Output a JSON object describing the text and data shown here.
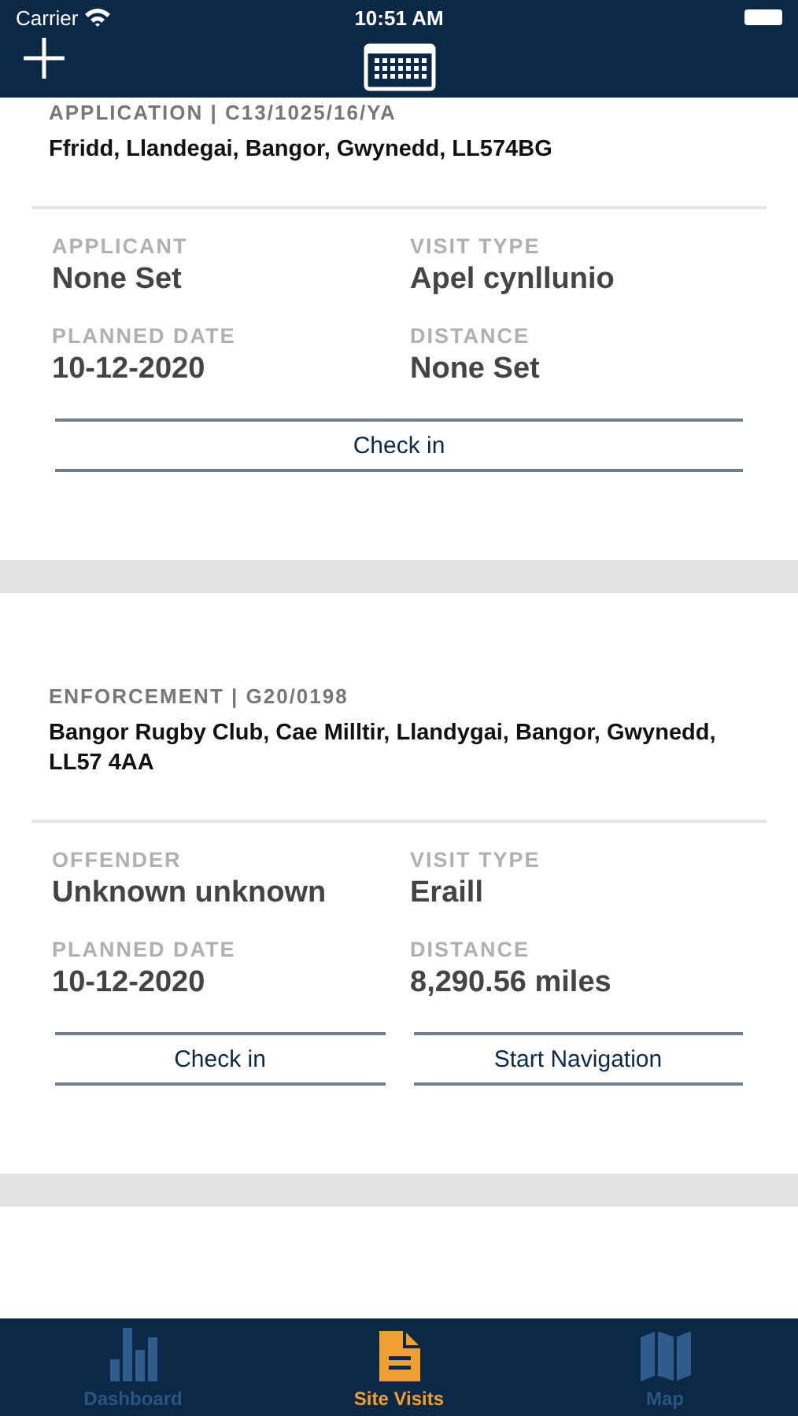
{
  "status_bar": {
    "carrier": "Carrier",
    "time": "10:51 AM"
  },
  "visits": [
    {
      "type": "APPLICATION | C13/1025/16/YA",
      "address": "Ffridd, Llandegai, Bangor, Gwynedd, LL574BG",
      "fields": [
        {
          "label": "APPLICANT",
          "value": "None Set"
        },
        {
          "label": "VISIT TYPE",
          "value": "Apel cynllunio"
        },
        {
          "label": "PLANNED DATE",
          "value": "10-12-2020"
        },
        {
          "label": "DISTANCE",
          "value": "None Set"
        }
      ],
      "buttons": [
        "Check in"
      ]
    },
    {
      "type": "ENFORCEMENT | G20/0198",
      "address": "Bangor Rugby Club, Cae Milltir, Llandygai, Bangor, Gwynedd, LL57 4AA",
      "fields": [
        {
          "label": "OFFENDER",
          "value": "Unknown unknown"
        },
        {
          "label": "VISIT TYPE",
          "value": "Eraill"
        },
        {
          "label": "PLANNED DATE",
          "value": "10-12-2020"
        },
        {
          "label": "DISTANCE",
          "value": "8,290.56 miles"
        }
      ],
      "buttons": [
        "Check in",
        "Start Navigation"
      ]
    }
  ],
  "tab_bar": [
    {
      "label": "Dashboard",
      "kind": "chart",
      "selected": false
    },
    {
      "label": "Site Visits",
      "kind": "document",
      "selected": true
    },
    {
      "label": "Map",
      "kind": "map",
      "selected": false
    }
  ]
}
